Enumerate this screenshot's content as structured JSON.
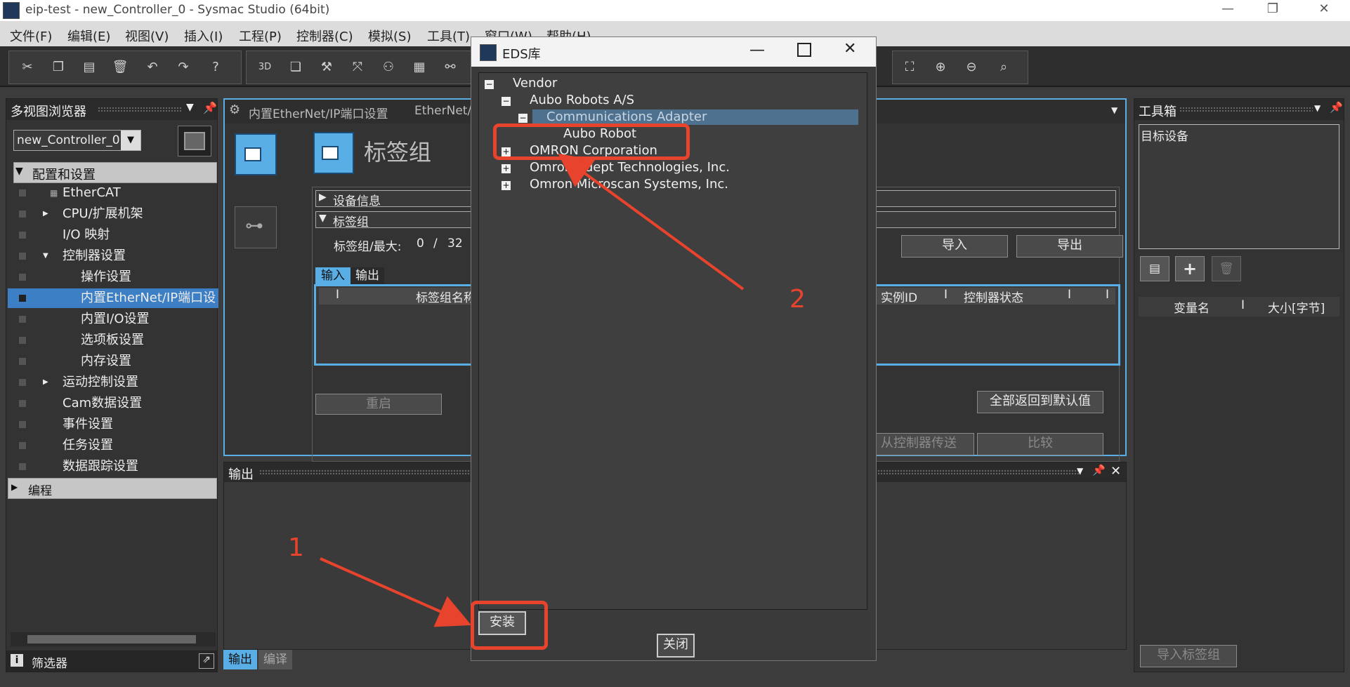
{
  "window": {
    "title": "eip-test - new_Controller_0 - Sysmac Studio (64bit)",
    "minimize": "—",
    "maximize": "❐",
    "close": "✕"
  },
  "menu": [
    "文件(F)",
    "编辑(E)",
    "视图(V)",
    "插入(I)",
    "工程(P)",
    "控制器(C)",
    "模拟(S)",
    "工具(T)",
    "窗口(W)",
    "帮助(H)"
  ],
  "left_panel": {
    "title": "多视图浏览器",
    "controller": "new_Controller_0",
    "section_config": "配置和设置",
    "items": [
      "EtherCAT",
      "CPU/扩展机架",
      "I/O 映射",
      "控制器设置",
      "操作设置",
      "内置EtherNet/IP端口设",
      "内置I/O设置",
      "选项板设置",
      "内存设置",
      "运动控制设置",
      "Cam数据设置",
      "事件设置",
      "任务设置",
      "数据跟踪设置"
    ],
    "section_program": "编程",
    "filter": "筛选器"
  },
  "doc": {
    "tab1": "内置EtherNet/IP端口设置",
    "tab2": "EtherNet/I",
    "title": "标签组",
    "device_info": "设备信息",
    "tag_group": "标签组",
    "tag_group_max_label": "标签组/最大:",
    "tag_group_count": "0",
    "tag_group_sep": "/",
    "tag_group_max": "32",
    "btn_import": "导入",
    "btn_export": "导出",
    "tab_input": "输入",
    "tab_output": "输出",
    "col_name": "标签组名称",
    "col_instance": "实例ID",
    "col_state": "控制器状态",
    "btn_restart": "重启",
    "btn_reset_all": "全部返回到默认值",
    "btn_transfer": "从控制器传送",
    "btn_compare": "比较"
  },
  "output_panel": {
    "title": "输出",
    "tab_output": "输出",
    "tab_compile": "编译"
  },
  "toolbox": {
    "title": "工具箱",
    "target": "目标设备",
    "col_var": "变量名",
    "col_size": "大小[字节]",
    "btn_import_tags": "导入标签组"
  },
  "eds_dialog": {
    "title": "EDS库",
    "root": "Vendor",
    "vendor1": "Aubo Robots A/S",
    "category": "Communications Adapter",
    "device": "Aubo Robot",
    "vendor2": "OMRON Corporation",
    "vendor3": "Omron Adept Technologies, Inc.",
    "vendor4": "Omron Microscan Systems, Inc.",
    "install": "安装",
    "close": "关闭"
  },
  "annotations": {
    "label1": "1",
    "label2": "2",
    "color": "#e8432c"
  },
  "colors": {
    "selection": "#3d7fc4",
    "highlight": "#4e7190",
    "accent_tab": "#5aaee6"
  }
}
